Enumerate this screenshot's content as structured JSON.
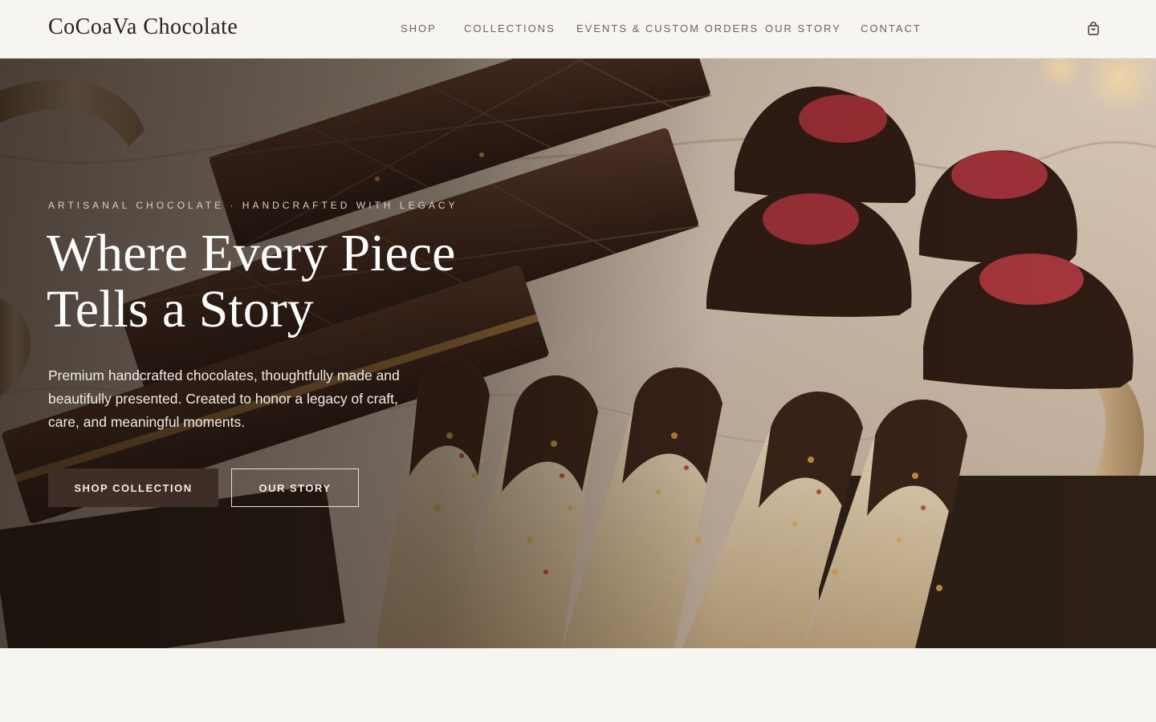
{
  "brand": {
    "name": "CoCoaVa Chocolate"
  },
  "nav": {
    "items": [
      "SHOP",
      "COLLECTIONS",
      "EVENTS & CUSTOM ORDERS",
      "OUR STORY",
      "CONTACT"
    ]
  },
  "cart": {
    "icon": "shopping-bag-icon"
  },
  "hero": {
    "eyebrow": "ARTISANAL CHOCOLATE · HANDCRAFTED WITH LEGACY",
    "headline": "Where Every Piece Tells a Story",
    "lead": "Premium handcrafted chocolates, thoughtfully made and beautifully presented. Created to honor a legacy of craft, care, and meaningful moments.",
    "primary_button": "SHOP COLLECTION",
    "secondary_button": "OUR STORY"
  },
  "colors": {
    "page_bg": "#f7f5f1",
    "header_text": "#2b221d",
    "nav_text": "#6d625a",
    "button_primary_bg": "#3f2e27",
    "button_text": "#f3ece5"
  }
}
